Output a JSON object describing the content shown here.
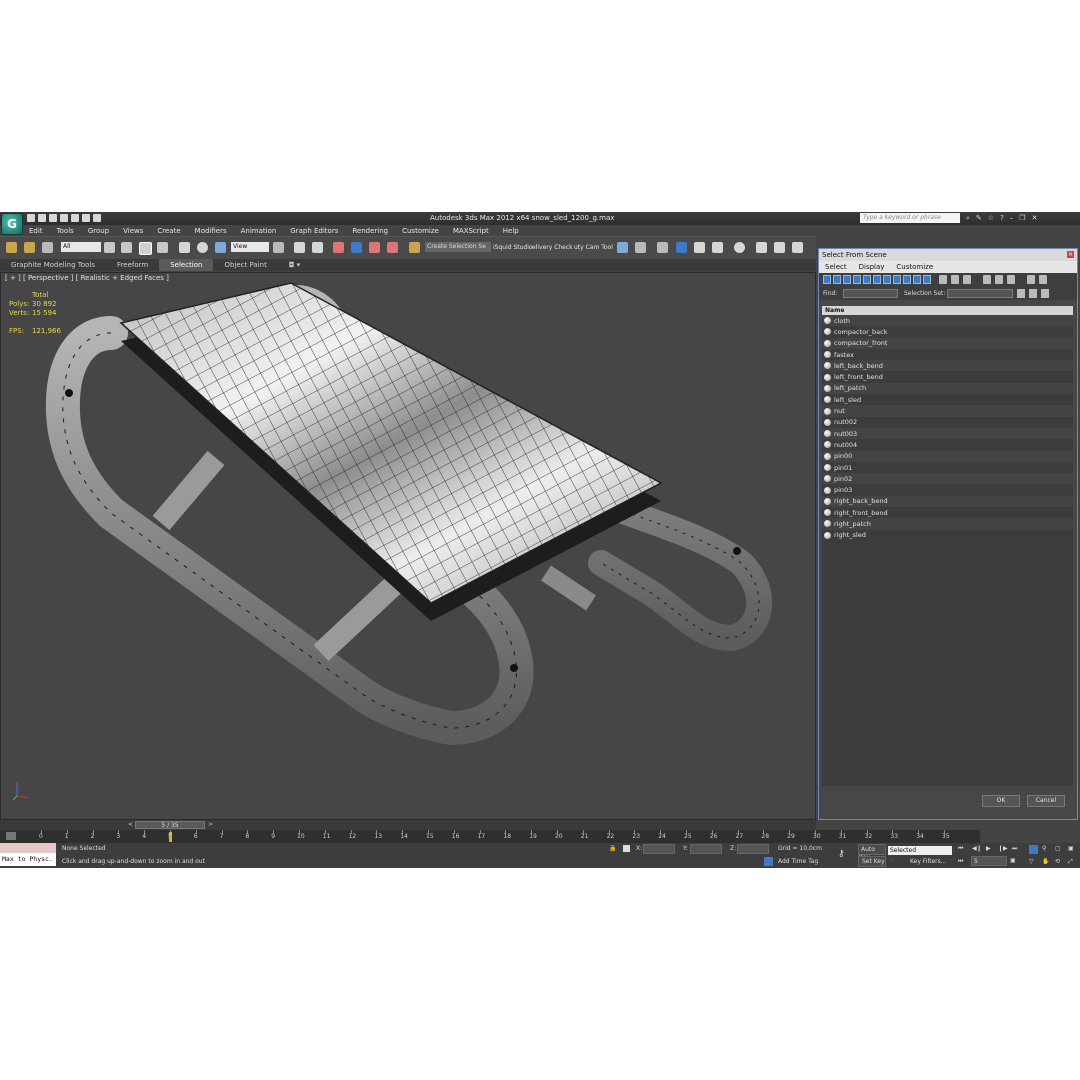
{
  "window": {
    "title": "Autodesk 3ds Max  2012 x64      snow_sled_1200_g.max",
    "search_placeholder": "Type a keyword or phrase",
    "logo_letter": "G"
  },
  "menu": [
    "Edit",
    "Tools",
    "Group",
    "Views",
    "Create",
    "Modifiers",
    "Animation",
    "Graph Editors",
    "Rendering",
    "Customize",
    "MAXScript",
    "Help"
  ],
  "toolbar": {
    "filter_value": "All",
    "ref_coord_value": "View",
    "selection_set_value": "Create Selection Se",
    "plugin_labels": [
      "iSquid Studio",
      "elivery Check",
      "uty Cam Tool"
    ]
  },
  "ribbon": {
    "tabs": [
      "Graphite Modeling Tools",
      "Freeform",
      "Selection",
      "Object Paint"
    ],
    "active_index": 2
  },
  "viewport": {
    "label": "[ + ] [ Perspective ] [ Realistic + Edged Faces ]",
    "stats": {
      "header": "Total",
      "polys_label": "Polys:",
      "polys_value": "30 892",
      "verts_label": "Verts:",
      "verts_value": "15 594",
      "fps_label": "FPS:",
      "fps_value": "121,966"
    }
  },
  "select_panel": {
    "title": "Select From Scene",
    "menu": [
      "Select",
      "Display",
      "Customize"
    ],
    "find_label": "Find:",
    "selection_set_label": "Selection Set:",
    "column_header": "Name",
    "items": [
      "cloth",
      "compactor_back",
      "compactor_front",
      "fastex",
      "left_back_bend",
      "left_front_bend",
      "left_patch",
      "left_sled",
      "nut",
      "nut002",
      "nut003",
      "nut004",
      "pin00",
      "pin01",
      "pin02",
      "pin03",
      "right_back_bend",
      "right_front_bend",
      "right_patch",
      "right_sled"
    ],
    "ok_label": "OK",
    "cancel_label": "Cancel"
  },
  "timeline": {
    "frame_display": "5 / 35",
    "current_frame": 5,
    "ticks": [
      "0",
      "1",
      "2",
      "3",
      "4",
      "5",
      "6",
      "7",
      "8",
      "9",
      "10",
      "11",
      "12",
      "13",
      "14",
      "15",
      "16",
      "17",
      "18",
      "19",
      "20",
      "21",
      "22",
      "23",
      "24",
      "25",
      "26",
      "27",
      "28",
      "29",
      "30",
      "31",
      "32",
      "33",
      "34",
      "35"
    ]
  },
  "status": {
    "maxscript_text": "Max to Physc.",
    "selection_status": "None Selected",
    "prompt": "Click and drag up-and-down to zoom in and out",
    "x_label": "X:",
    "y_label": "Y:",
    "z_label": "Z:",
    "grid": "Grid = 10,0cm",
    "add_time_tag": "Add Time Tag",
    "auto_key": "Auto Key",
    "set_key": "Set Key",
    "key_mode_value": "Selected",
    "key_filters": "Key Filters...",
    "frame_field": "5"
  },
  "colors": {
    "ui_background": "#444444",
    "viewport_background": "#464646",
    "accent_blue": "#3f79c8",
    "stats_yellow": "#e9d64a"
  }
}
